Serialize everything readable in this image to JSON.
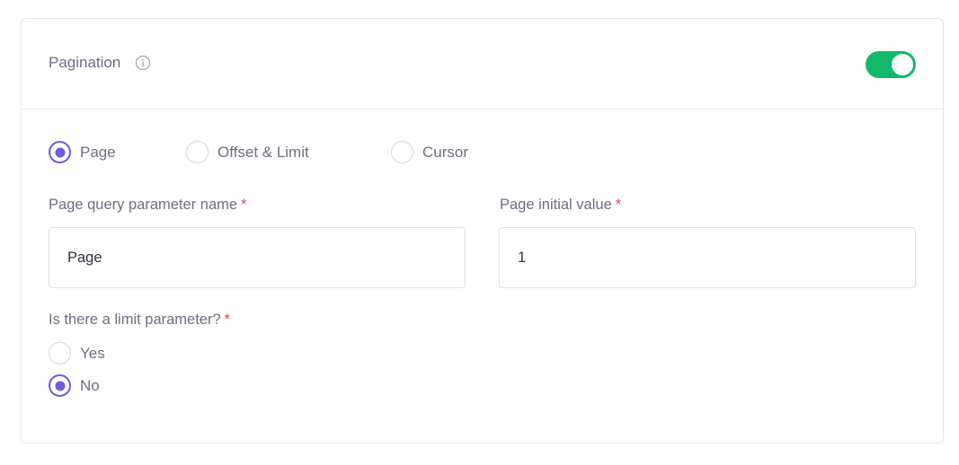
{
  "pagination": {
    "title": "Pagination",
    "enabled": true
  },
  "pagination_types": [
    {
      "label": "Page",
      "checked": true
    },
    {
      "label": "Offset & Limit",
      "checked": false
    },
    {
      "label": "Cursor",
      "checked": false
    }
  ],
  "fields": {
    "page_param": {
      "label": "Page query parameter name",
      "required": "*",
      "value": "Page"
    },
    "page_initial": {
      "label": "Page initial value",
      "required": "*",
      "value": "1"
    }
  },
  "limit_question": {
    "label": "Is there a limit parameter?",
    "required": "*",
    "options": [
      {
        "label": "Yes",
        "checked": false
      },
      {
        "label": "No",
        "checked": true
      }
    ]
  },
  "colors": {
    "accent": "#14b86a",
    "radio": "#6a5fdb",
    "required": "#e5484d"
  }
}
